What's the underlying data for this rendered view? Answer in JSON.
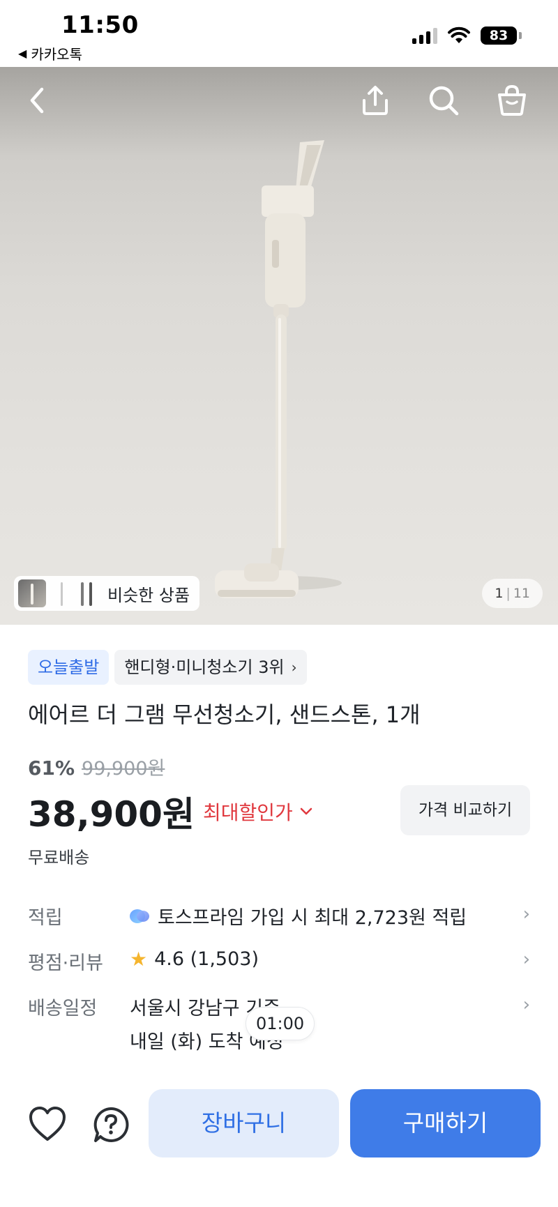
{
  "status_bar": {
    "time": "11:50",
    "back_app": "카카오톡",
    "battery": "83"
  },
  "hero": {
    "similar_products_label": "비슷한 상품",
    "page_current": "1",
    "page_total": "11",
    "icons": [
      "back-icon",
      "share-icon",
      "search-icon",
      "shopping-bag-icon"
    ]
  },
  "product": {
    "badge_today": "오늘출발",
    "badge_ranking": "핸디형·미니청소기 3위",
    "title": "에어르 더 그램 무선청소기, 샌드스톤, 1개",
    "discount_rate": "61%",
    "original_price": "99,900원",
    "sale_price": "38,900원",
    "max_discount_label": "최대할인가",
    "compare_button": "가격 비교하기",
    "shipping": "무료배송"
  },
  "info": {
    "points_label": "적립",
    "points_value": "토스프라임 가입 시 최대 2,723원 적립",
    "rating_label": "평점·리뷰",
    "rating_value": "4.6 (1,503)",
    "delivery_label": "배송일정",
    "delivery_value_line1": "서울시 강남구 기준",
    "delivery_value_line2": "내일 (화) 도착 예정",
    "timer": "01:00"
  },
  "bottom_bar": {
    "cart_button": "장바구니",
    "buy_button": "구매하기"
  },
  "colors": {
    "primary": "#3f7ce8",
    "primary_light": "#e3ecfb",
    "discount_red": "#e0383e",
    "badge_blue_bg": "#e9f1ff",
    "star": "#f5b52e"
  }
}
